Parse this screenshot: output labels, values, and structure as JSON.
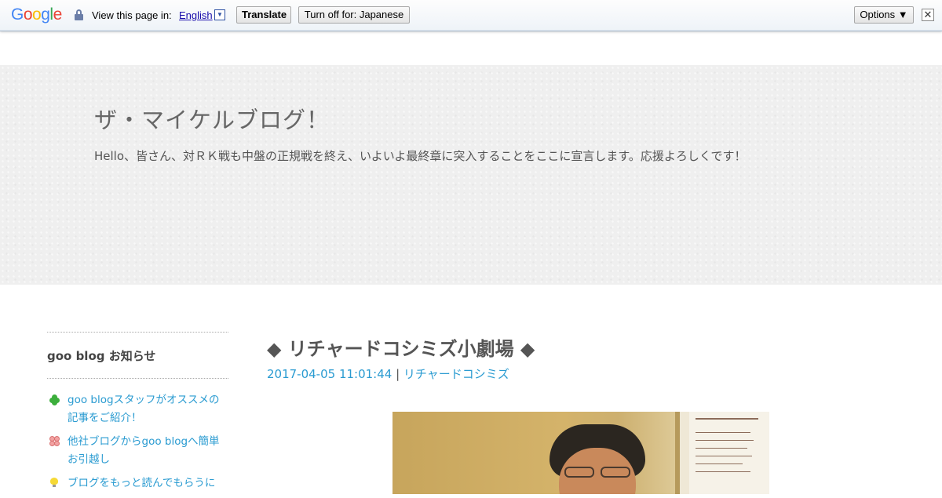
{
  "translate_bar": {
    "logo": [
      "G",
      "o",
      "o",
      "g",
      "l",
      "e"
    ],
    "logo_colors": [
      "#4285f4",
      "#ea4335",
      "#fbbc05",
      "#4285f4",
      "#34a853",
      "#ea4335"
    ],
    "view_label": "View this page in:",
    "language": "English",
    "translate_button": "Translate",
    "turn_off_button": "Turn off for: Japanese",
    "options_button": "Options ▼",
    "close_glyph": "✕"
  },
  "header": {
    "blog_title": "ザ・マイケルブログ！",
    "description": "Hello、皆さん、対ＲＫ戦も中盤の正規戦を終え、いよいよ最終章に突入することをここに宣言します。応援よろしくです！"
  },
  "sidebar": {
    "heading": "goo blog お知らせ",
    "items": [
      {
        "label": "goo blogスタッフがオススメの記事をご紹介！",
        "icon": "clover-icon"
      },
      {
        "label": "他社ブログからgoo blogへ簡単お引越し",
        "icon": "flower-icon"
      },
      {
        "label": "ブログをもっと読んでもらうに",
        "icon": "lightbulb-icon"
      }
    ]
  },
  "post": {
    "title": "◆ リチャードコシミズ小劇場 ◆",
    "datetime": "2017-04-05 11:01:44",
    "separator": " | ",
    "category": "リチャードコシミズ"
  },
  "colors": {
    "link": "#2a9bd1",
    "header_bg": "#efefef",
    "title_text": "#666666"
  }
}
